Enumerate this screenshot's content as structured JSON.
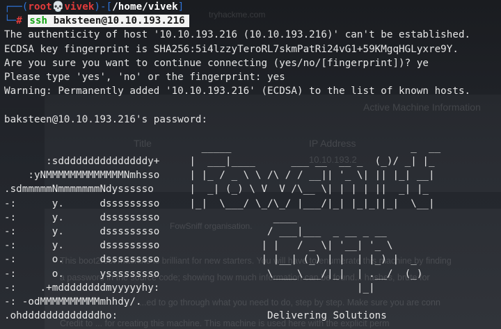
{
  "prompt": {
    "user": "root",
    "skull": "💀",
    "host": "vivek",
    "path": "/home/vivek",
    "hash": "#",
    "command_name": "ssh",
    "command_args": "baksteen@10.10.193.216"
  },
  "output": [
    "The authenticity of host '10.10.193.216 (10.10.193.216)' can't be established.",
    "ECDSA key fingerprint is SHA256:5i4lzzyTeroRL7skmPatRi24vG1+59KMgqHGLyxre9Y.",
    "Are you sure you want to continue connecting (yes/no/[fingerprint])? ye",
    "Please type 'yes', 'no' or the fingerprint: yes",
    "Warning: Permanently added '10.10.193.216' (ECDSA) to the list of known hosts.",
    "",
    "baksteen@10.10.193.216's password:",
    "",
    "                                 _____                              _  __",
    "       :sdddddddddddddddy+     |  ___|____      ___ __  __ _  (_)/ _| |_",
    "    :yNMMMMMMMMMMMMMNmhsso     | |_ / _ \\ \\ /\\ / / __|| '_ \\| || |_| __|",
    ".sdmmmmmNmmmmmmmNdyssssso      |  _| (_) \\ V  V /\\__ \\| | | | ||  _| |_",
    "-:      y.      dsssssssso     |_|  \\___/ \\_/\\_/ |___/|_| |_|_||_|  \\__|",
    "-:      y.      dsssssssso                   ____",
    "-:      y.      dsssssssso                  / ___|___  _ __ _ __",
    "-:      y.      dsssssssso                 | |   / _ \\| '__| '_ \\",
    "-:      o.      dsssssssso                 | |__| (_) | |  | |_) |  _",
    "-:      o.      ysssssssso                  \\____\\___/|_|  | .__/  (_)",
    "-:    .+mddddddddmyyyyyhy:                                 |_|",
    "-: -odMMMMMMMMMMmhhdy/.",
    ".ohdddddddddddddho:                         Delivering Solutions"
  ],
  "background_ghost": {
    "site": "tryhackme.com",
    "panel_title": "Active Machine Information",
    "col_title": "Title",
    "col_ip": "IP Address",
    "ip_partial": "10.10.193.2",
    "org_line": "FowSniff organisation.",
    "text1": "This boot2root machine is brilliant for new starters. You will have to enumerate this machine by finding",
    "text2": "a password in the source code; showing how much information can be found... hashes, brute for",
    "text3": "...ed to go through what you need to do, step by step. Make sure you are conn",
    "text4": "Credit to ... for creating this machine. This machine is used here with the explicit perm"
  }
}
